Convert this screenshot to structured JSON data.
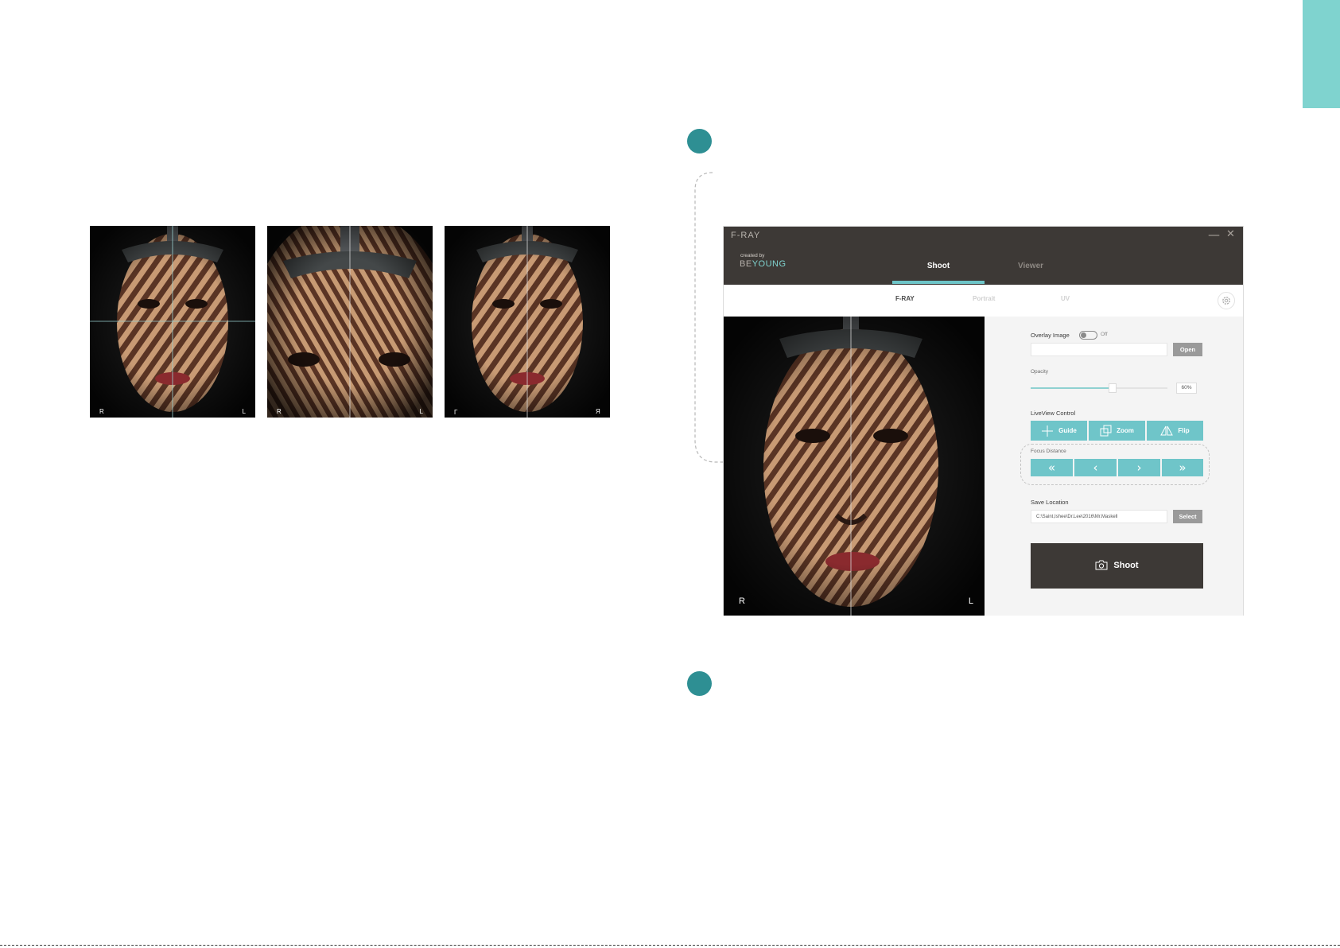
{
  "thumbnails": [
    {
      "left_label": "R",
      "right_label": "L",
      "variant": "crosshair"
    },
    {
      "left_label": "R",
      "right_label": "L",
      "variant": "zoom"
    },
    {
      "left_label": "L",
      "right_label": "R",
      "variant": "flip"
    }
  ],
  "app": {
    "title": "F-RAY",
    "window_controls": {
      "minimize": "—",
      "close": "✕"
    },
    "brand": {
      "caption": "created by",
      "name_prefix": "BE",
      "name_accent": "YOUNG"
    },
    "main_tabs": [
      {
        "label": "Shoot",
        "active": true
      },
      {
        "label": "Viewer",
        "active": false
      }
    ],
    "sub_tabs": [
      {
        "label": "F-RAY",
        "active": true
      },
      {
        "label": "Portrait",
        "active": false
      },
      {
        "label": "UV",
        "active": false
      }
    ],
    "liveview": {
      "left_label": "R",
      "right_label": "L"
    },
    "panel": {
      "overlay_label": "Overlay Image",
      "overlay_toggle_state": "Off",
      "overlay_path": "",
      "open_label": "Open",
      "opacity_label": "Opacity",
      "opacity_value": "60%",
      "opacity_fraction": 0.6,
      "liveview_control_label": "LiveView Control",
      "guide_label": "Guide",
      "zoom_label": "Zoom",
      "flip_label": "Flip",
      "focus_label": "Focus Distance",
      "focus_buttons": [
        "«",
        "‹",
        "›",
        "»"
      ],
      "save_location_label": "Save Location",
      "save_path": "C:\\Saint,Ishee\\Dr.Lee\\2016\\Mr.Maskell",
      "select_label": "Select",
      "shoot_label": "Shoot"
    }
  },
  "colors": {
    "accent": "#6fc5c9",
    "corner_tab": "#7fd3cf",
    "step_dot": "#2e8f93",
    "titlebar": "#3d3936"
  },
  "icons": [
    "gear-icon",
    "guide-icon",
    "zoom-icon",
    "flip-icon",
    "camera-icon"
  ]
}
